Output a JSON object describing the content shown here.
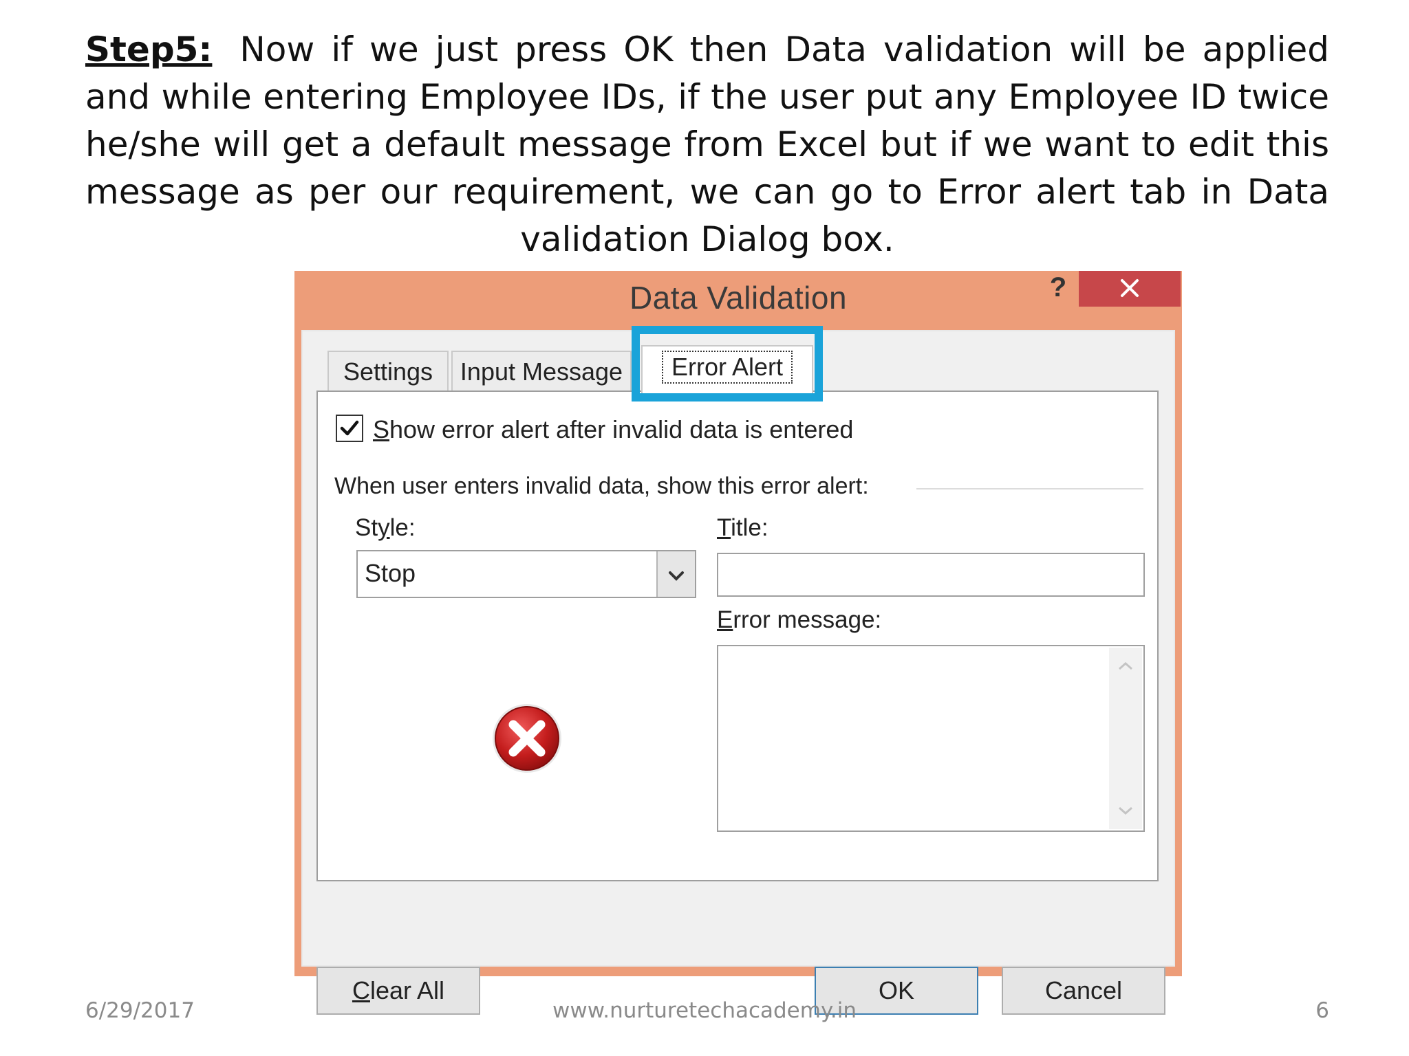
{
  "slide": {
    "step_label": "Step5:",
    "body_text": "Now if we just press OK then Data validation will be applied and while entering Employee IDs, if the user put any Employee ID twice he/she will get a default message from Excel but if we want to edit this message as per our requirement, we can go to Error alert tab in Data validation Dialog box."
  },
  "dialog": {
    "title": "Data Validation",
    "help_label": "?",
    "close_icon": "close-icon",
    "tabs": [
      {
        "label": "Settings",
        "active": false
      },
      {
        "label": "Input Message",
        "active": false
      },
      {
        "label": "Error Alert",
        "active": true
      }
    ],
    "highlight_color": "#1aa3d9",
    "checkbox": {
      "checked": true,
      "mnemonic": "S",
      "label_rest": "how error alert after invalid data is entered"
    },
    "group_label": "When user enters invalid data, show this error alert:",
    "style": {
      "label_pre": "St",
      "mnemonic": "y",
      "label_post": "le:",
      "value": "Stop"
    },
    "title_field": {
      "mnemonic": "T",
      "label_rest": "itle:",
      "value": ""
    },
    "error_message_field": {
      "mnemonic": "E",
      "label_rest": "rror message:",
      "value": ""
    },
    "style_icon": "stop-error-icon",
    "buttons": {
      "clear_all_mnemonic": "C",
      "clear_all_rest": "lear All",
      "ok": "OK",
      "cancel": "Cancel"
    }
  },
  "footer": {
    "date": "6/29/2017",
    "website": "www.nurturetechacademy.in",
    "page_number": "6"
  },
  "colors": {
    "titlebar": "#ed9d79",
    "close_button": "#c7474a",
    "accent_highlight": "#1aa3d9"
  }
}
